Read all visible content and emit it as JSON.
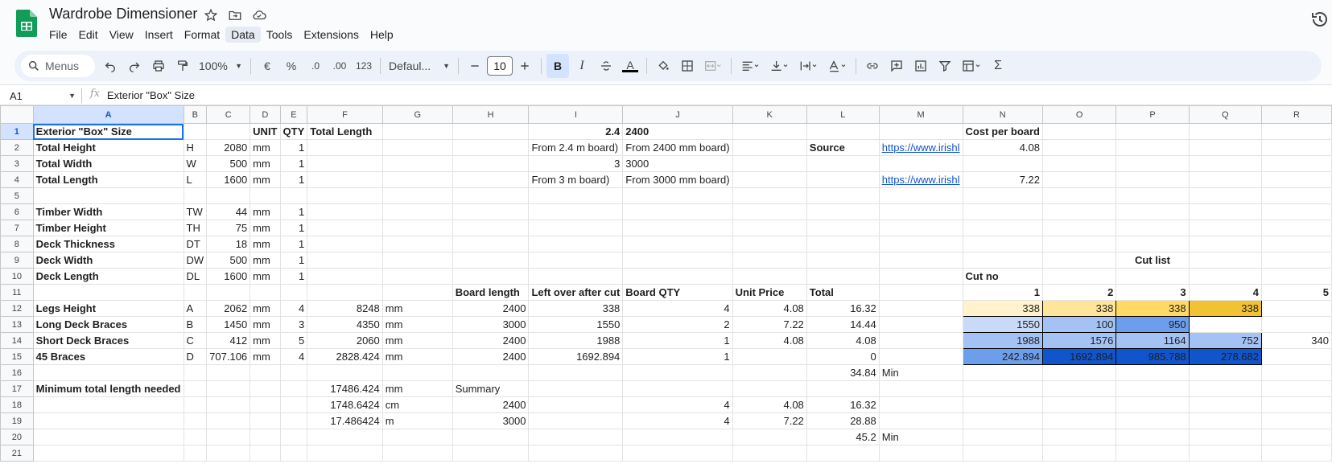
{
  "app": {
    "title": "Wardrobe Dimensioner",
    "menus": [
      "File",
      "Edit",
      "View",
      "Insert",
      "Format",
      "Data",
      "Tools",
      "Extensions",
      "Help"
    ],
    "active_menu": "Data"
  },
  "toolbar": {
    "search_placeholder": "Menus",
    "zoom": "100%",
    "currency": "€",
    "percent": "%",
    "decrease_decimals": ".0",
    "increase_decimals": ".00",
    "number_format": "123",
    "font": "Defaul...",
    "font_size": "10",
    "bold": "B",
    "italic": "I",
    "text_color_letter": "A"
  },
  "formula_bar": {
    "cell_ref": "A1",
    "fx": "fx",
    "content": "Exterior \"Box\" Size"
  },
  "columns": [
    "A",
    "B",
    "C",
    "D",
    "E",
    "F",
    "G",
    "H",
    "I",
    "J",
    "K",
    "L",
    "M",
    "N",
    "O",
    "P",
    "Q",
    "R"
  ],
  "rows": [
    [
      {
        "t": "Exterior \"Box\" Size",
        "b": 1,
        "active": 1
      },
      "",
      {
        "t": ""
      },
      {
        "t": "UNIT",
        "b": 1
      },
      {
        "t": "QTY",
        "b": 1
      },
      {
        "t": "Total Length",
        "b": 1
      },
      "",
      "",
      {
        "t": "2.4",
        "b": 1,
        "r": 1
      },
      {
        "t": "2400",
        "b": 1
      },
      "",
      "",
      "",
      {
        "t": "Cost per board",
        "b": 1,
        "o": 1
      },
      "",
      "",
      "",
      ""
    ],
    [
      {
        "t": "Total Height",
        "b": 1
      },
      "H",
      {
        "t": "2080",
        "r": 1
      },
      "mm",
      {
        "t": "1",
        "r": 1
      },
      "",
      "",
      "",
      {
        "t": "From 2.4 m board)",
        "o": 1
      },
      {
        "t": "From 2400 mm board)",
        "o": 1
      },
      "",
      {
        "t": "Source",
        "b": 1
      },
      {
        "t": "https://www.irishl",
        "link": 1
      },
      {
        "t": "4.08",
        "r": 1
      },
      "",
      "",
      "",
      ""
    ],
    [
      {
        "t": "Total Width",
        "b": 1
      },
      "W",
      {
        "t": "500",
        "r": 1
      },
      "mm",
      {
        "t": "1",
        "r": 1
      },
      "",
      "",
      "",
      {
        "t": "3",
        "r": 1
      },
      {
        "t": "3000"
      },
      "",
      "",
      "",
      "",
      "",
      "",
      "",
      ""
    ],
    [
      {
        "t": "Total Length",
        "b": 1
      },
      "L",
      {
        "t": "1600",
        "r": 1
      },
      "mm",
      {
        "t": "1",
        "r": 1
      },
      "",
      "",
      "",
      {
        "t": "From 3 m board)",
        "o": 1
      },
      {
        "t": "From 3000 mm board)",
        "o": 1
      },
      "",
      "",
      {
        "t": "https://www.irishl",
        "link": 1
      },
      {
        "t": "7.22",
        "r": 1
      },
      "",
      "",
      "",
      ""
    ],
    [
      "",
      "",
      "",
      "",
      "",
      "",
      "",
      "",
      "",
      "",
      "",
      "",
      "",
      "",
      "",
      "",
      "",
      ""
    ],
    [
      {
        "t": "Timber Width",
        "b": 1
      },
      "TW",
      {
        "t": "44",
        "r": 1
      },
      "mm",
      {
        "t": "1",
        "r": 1
      },
      "",
      "",
      "",
      "",
      "",
      "",
      "",
      "",
      "",
      "",
      "",
      "",
      ""
    ],
    [
      {
        "t": "Timber Height",
        "b": 1
      },
      "TH",
      {
        "t": "75",
        "r": 1
      },
      "mm",
      {
        "t": "1",
        "r": 1
      },
      "",
      "",
      "",
      "",
      "",
      "",
      "",
      "",
      "",
      "",
      "",
      "",
      ""
    ],
    [
      {
        "t": "Deck Thickness",
        "b": 1
      },
      "DT",
      {
        "t": "18",
        "r": 1
      },
      "mm",
      {
        "t": "1",
        "r": 1
      },
      "",
      "",
      "",
      "",
      "",
      "",
      "",
      "",
      "",
      "",
      "",
      "",
      ""
    ],
    [
      {
        "t": "Deck Width",
        "b": 1
      },
      "DW",
      {
        "t": "500",
        "r": 1
      },
      "mm",
      {
        "t": "1",
        "r": 1
      },
      "",
      "",
      "",
      "",
      "",
      "",
      "",
      "",
      "",
      "",
      {
        "t": "Cut list",
        "b": 1,
        "c": 1
      },
      "",
      ""
    ],
    [
      {
        "t": "Deck Length",
        "b": 1
      },
      "DL",
      {
        "t": "1600",
        "r": 1
      },
      "mm",
      {
        "t": "1",
        "r": 1
      },
      "",
      "",
      "",
      "",
      "",
      "",
      "",
      "",
      {
        "t": "Cut no",
        "b": 1
      },
      "",
      "",
      "",
      ""
    ],
    [
      "",
      "",
      "",
      "",
      "",
      "",
      "",
      {
        "t": "Board length",
        "b": 1
      },
      {
        "t": "Left over after cut",
        "b": 1
      },
      {
        "t": "Board QTY",
        "b": 1
      },
      {
        "t": "Unit Price",
        "b": 1
      },
      {
        "t": "Total",
        "b": 1
      },
      "",
      {
        "t": "1",
        "b": 1,
        "r": 1
      },
      {
        "t": "2",
        "b": 1,
        "r": 1
      },
      {
        "t": "3",
        "b": 1,
        "r": 1
      },
      {
        "t": "4",
        "b": 1,
        "r": 1
      },
      {
        "t": "5",
        "b": 1,
        "r": 1
      }
    ],
    [
      {
        "t": "Legs Height",
        "b": 1
      },
      "A",
      {
        "t": "2062",
        "r": 1
      },
      "mm",
      {
        "t": "4",
        "r": 1
      },
      {
        "t": "8248",
        "r": 1
      },
      "mm",
      {
        "t": "2400",
        "r": 1
      },
      {
        "t": "338",
        "r": 1
      },
      {
        "t": "4",
        "r": 1
      },
      {
        "t": "4.08",
        "r": 1
      },
      {
        "t": "16.32",
        "r": 1
      },
      "",
      {
        "t": "338",
        "r": 1,
        "bg": "#fff2cc"
      },
      {
        "t": "338",
        "r": 1,
        "bg": "#ffe599"
      },
      {
        "t": "338",
        "r": 1,
        "bg": "#ffd966"
      },
      {
        "t": "338",
        "r": 1,
        "bg": "#f1c232"
      },
      ""
    ],
    [
      {
        "t": "Long Deck Braces",
        "b": 1
      },
      "B",
      {
        "t": "1450",
        "r": 1
      },
      "mm",
      {
        "t": "3",
        "r": 1
      },
      {
        "t": "4350",
        "r": 1
      },
      "mm",
      {
        "t": "3000",
        "r": 1
      },
      {
        "t": "1550",
        "r": 1
      },
      {
        "t": "2",
        "r": 1
      },
      {
        "t": "7.22",
        "r": 1
      },
      {
        "t": "14.44",
        "r": 1
      },
      "",
      {
        "t": "1550",
        "r": 1,
        "bg": "#c9daf8"
      },
      {
        "t": "100",
        "r": 1,
        "bg": "#a4c2f4"
      },
      {
        "t": "950",
        "r": 1,
        "bg": "#6d9eeb"
      },
      "",
      ""
    ],
    [
      {
        "t": "Short Deck Braces",
        "b": 1
      },
      "C",
      {
        "t": "412",
        "r": 1
      },
      "mm",
      {
        "t": "5",
        "r": 1
      },
      {
        "t": "2060",
        "r": 1
      },
      "mm",
      {
        "t": "2400",
        "r": 1
      },
      {
        "t": "1988",
        "r": 1
      },
      {
        "t": "1",
        "r": 1
      },
      {
        "t": "4.08",
        "r": 1
      },
      {
        "t": "4.08",
        "r": 1
      },
      "",
      {
        "t": "1988",
        "r": 1,
        "bg": "#a4c2f4"
      },
      {
        "t": "1576",
        "r": 1,
        "bg": "#a4c2f4"
      },
      {
        "t": "1164",
        "r": 1,
        "bg": "#a4c2f4"
      },
      {
        "t": "752",
        "r": 1,
        "bg": "#a4c2f4"
      },
      {
        "t": "340",
        "r": 1
      }
    ],
    [
      {
        "t": "45 Braces",
        "b": 1
      },
      "D",
      {
        "t": "707.106",
        "r": 1
      },
      "mm",
      {
        "t": "4",
        "r": 1
      },
      {
        "t": "2828.424",
        "r": 1
      },
      "mm",
      {
        "t": "2400",
        "r": 1
      },
      {
        "t": "1692.894",
        "r": 1
      },
      {
        "t": "1",
        "r": 1
      },
      "",
      {
        "t": "0",
        "r": 1
      },
      "",
      {
        "t": "242.894",
        "r": 1,
        "bg": "#6d9eeb"
      },
      {
        "t": "1692.894",
        "r": 1,
        "bg": "#1155cc"
      },
      {
        "t": "985.788",
        "r": 1,
        "bg": "#1155cc"
      },
      {
        "t": "278.682",
        "r": 1,
        "bg": "#1155cc"
      },
      ""
    ],
    [
      "",
      "",
      "",
      "",
      "",
      "",
      "",
      "",
      "",
      "",
      "",
      {
        "t": "34.84",
        "r": 1
      },
      "Min",
      "",
      "",
      "",
      "",
      ""
    ],
    [
      {
        "t": "Minimum total length needed",
        "b": 1,
        "o": 1
      },
      "",
      "",
      "",
      "",
      {
        "t": "17486.424",
        "r": 1
      },
      "mm",
      "Summary",
      "",
      "",
      "",
      "",
      "",
      "",
      "",
      "",
      "",
      ""
    ],
    [
      "",
      "",
      "",
      "",
      "",
      {
        "t": "1748.6424",
        "r": 1
      },
      "cm",
      {
        "t": "2400",
        "r": 1
      },
      "",
      {
        "t": "4",
        "r": 1
      },
      {
        "t": "4.08",
        "r": 1
      },
      {
        "t": "16.32",
        "r": 1
      },
      "",
      "",
      "",
      "",
      "",
      ""
    ],
    [
      "",
      "",
      "",
      "",
      "",
      {
        "t": "17.486424",
        "r": 1
      },
      "m",
      {
        "t": "3000",
        "r": 1
      },
      "",
      {
        "t": "4",
        "r": 1
      },
      {
        "t": "7.22",
        "r": 1
      },
      {
        "t": "28.88",
        "r": 1
      },
      "",
      "",
      "",
      "",
      "",
      ""
    ],
    [
      "",
      "",
      "",
      "",
      "",
      "",
      "",
      "",
      "",
      "",
      "",
      {
        "t": "45.2",
        "r": 1
      },
      "Min",
      "",
      "",
      "",
      "",
      ""
    ],
    [
      "",
      "",
      "",
      "",
      "",
      "",
      "",
      "",
      "",
      "",
      "",
      "",
      "",
      "",
      "",
      "",
      "",
      ""
    ]
  ]
}
